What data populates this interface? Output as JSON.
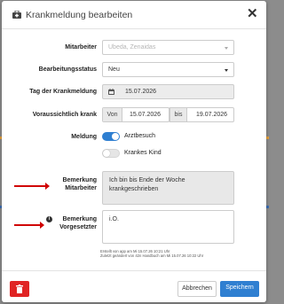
{
  "dialog": {
    "title": "Krankmeldung bearbeiten",
    "icon": "medical-kit-icon",
    "close_symbol": "✕"
  },
  "form": {
    "mitarbeiter": {
      "label": "Mitarbeiter",
      "placeholder": "Ubeda, Zenaidas"
    },
    "status": {
      "label": "Bearbeitungsstatus",
      "value": "Neu"
    },
    "tag": {
      "label": "Tag der Krankmeldung",
      "value": "15.07.2026",
      "icon": "calendar-icon"
    },
    "voraussichtlich": {
      "label": "Voraussichtlich krank",
      "von_label": "Von",
      "von_value": "15.07.2026",
      "bis_label": "bis",
      "bis_value": "19.07.2026"
    },
    "meldung": {
      "label": "Meldung",
      "toggles": [
        {
          "label": "Arztbesuch",
          "on": true
        },
        {
          "label": "Krankes Kind",
          "on": false
        }
      ]
    },
    "bemerkung_mitarbeiter": {
      "label_line1": "Bemerkung",
      "label_line2": "Mitarbeiter",
      "value_line1": "Ich bin bis Ende der Woche",
      "value_line2": "krankgeschrieben"
    },
    "bemerkung_vorgesetzter": {
      "label_line1": "Bemerkung",
      "label_line2": "Vorgesetzter",
      "value": "i.O.",
      "info_symbol": "i"
    },
    "meta_line1": "Erstellt von app am Mi 15.07.26 10:21 Uhr",
    "meta_line2": "Zuletzt geändert von 42n Handbuch am Mi 15.07.26 10:22 Uhr"
  },
  "footer": {
    "delete_icon": "trash-icon",
    "cancel_label": "Abbrechen",
    "save_label": "Speichern"
  },
  "colors": {
    "accent": "#2f7fd1",
    "danger": "#e02424",
    "annotation_arrow": "#d00000",
    "toggle_off": "#e5e5e5"
  }
}
